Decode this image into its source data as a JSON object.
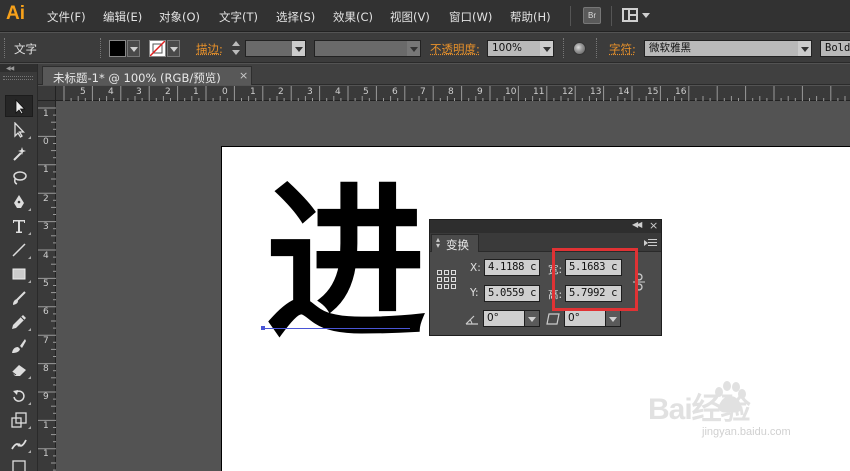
{
  "app": {
    "logo": "Ai"
  },
  "menu": {
    "items": [
      "文件(F)",
      "编辑(E)",
      "对象(O)",
      "文字(T)",
      "选择(S)",
      "效果(C)",
      "视图(V)",
      "窗口(W)",
      "帮助(H)"
    ],
    "bridge_label": "Br"
  },
  "control_bar": {
    "selection_type": "文字",
    "stroke_label": "描边:",
    "opacity_label": "不透明度:",
    "opacity_value": "100%",
    "character_label": "字符:",
    "font_family": "微软雅黑",
    "font_style": "Bold"
  },
  "document_tab": {
    "label": "未标题-1* @ 100% (RGB/预览)",
    "close": "×"
  },
  "rulers": {
    "horizontal": [
      "5",
      "4",
      "3",
      "2",
      "1",
      "0",
      "1",
      "2",
      "3",
      "4",
      "5",
      "6",
      "7",
      "8",
      "9",
      "10",
      "11",
      "12",
      "13",
      "14",
      "15",
      "16"
    ],
    "vertical": [
      "1",
      "0",
      "1",
      "2",
      "3",
      "4",
      "5",
      "6",
      "7",
      "8",
      "9",
      "1",
      "1"
    ]
  },
  "canvas": {
    "text": "进"
  },
  "transform_panel": {
    "tab_label": "变换",
    "x_label": "X:",
    "x_value": "4.1188 c",
    "y_label": "Y:",
    "y_value": "5.0559 c",
    "w_label": "宽:",
    "w_value": "5.1683 c",
    "h_label": "高:",
    "h_value": "5.7992 c",
    "rotate_value": "0°",
    "shear_value": "0°"
  },
  "watermark": {
    "brand": "Bai经验",
    "url": "jingyan.baidu.com"
  },
  "colors": {
    "accent": "#f7a11a",
    "highlight": "#e03234",
    "label_orange": "#e8912a"
  }
}
